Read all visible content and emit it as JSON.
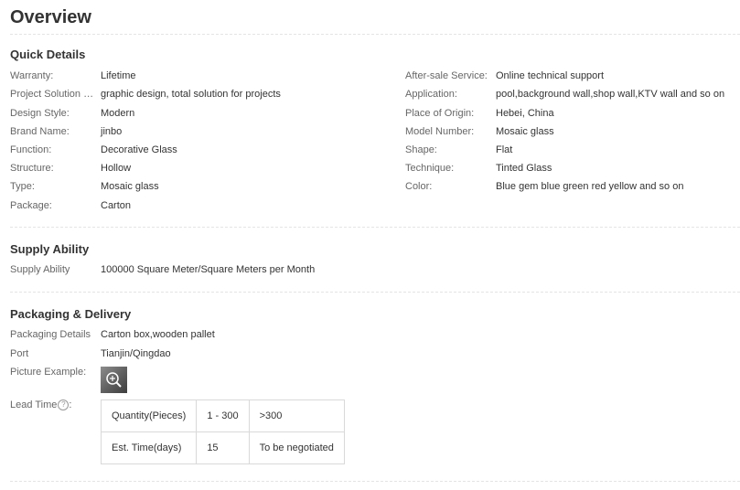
{
  "page_title": "Overview",
  "quick_details": {
    "title": "Quick Details",
    "left": [
      {
        "label": "Warranty:",
        "value": "Lifetime"
      },
      {
        "label": "Project Solution Ca...",
        "value": "graphic design, total solution for projects"
      },
      {
        "label": "Design Style:",
        "value": "Modern"
      },
      {
        "label": "Brand Name:",
        "value": "jinbo"
      },
      {
        "label": "Function:",
        "value": "Decorative Glass"
      },
      {
        "label": "Structure:",
        "value": "Hollow"
      },
      {
        "label": "Type:",
        "value": "Mosaic glass"
      },
      {
        "label": "Package:",
        "value": "Carton"
      }
    ],
    "right": [
      {
        "label": "After-sale Service:",
        "value": "Online technical support"
      },
      {
        "label": "Application:",
        "value": "pool,background wall,shop wall,KTV wall and so on"
      },
      {
        "label": "Place of Origin:",
        "value": "Hebei, China"
      },
      {
        "label": "Model Number:",
        "value": "Mosaic glass"
      },
      {
        "label": "Shape:",
        "value": "Flat"
      },
      {
        "label": "Technique:",
        "value": "Tinted Glass"
      },
      {
        "label": "Color:",
        "value": "Blue gem blue green red yellow and so on"
      }
    ]
  },
  "supply_ability": {
    "title": "Supply Ability",
    "label": "Supply Ability",
    "value": "100000 Square Meter/Square Meters per Month"
  },
  "packaging_delivery": {
    "title": "Packaging & Delivery",
    "details_label": "Packaging Details",
    "details_value": "Carton box,wooden pallet",
    "port_label": "Port",
    "port_value": "Tianjin/Qingdao",
    "picture_label": "Picture Example:",
    "lead_time_label": "Lead Time",
    "help_glyph": "?",
    "lead_time_colon": ":",
    "lead_table": {
      "rows": [
        [
          "Quantity(Pieces)",
          "1 - 300",
          ">300"
        ],
        [
          "Est. Time(days)",
          "15",
          "To be negotiated"
        ]
      ]
    }
  }
}
